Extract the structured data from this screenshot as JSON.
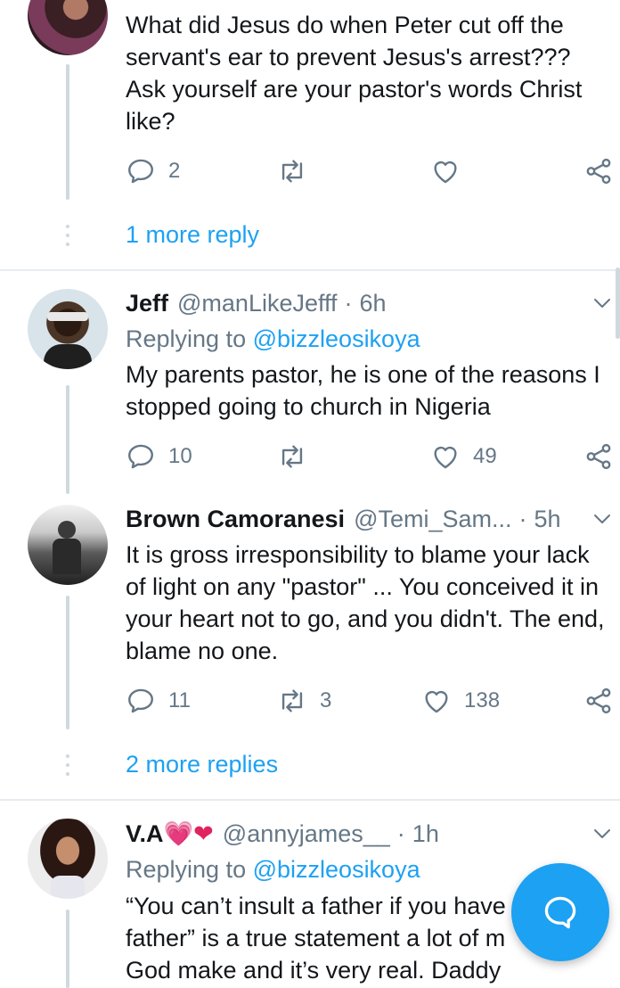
{
  "tweets": [
    {
      "text": "What did Jesus do when Peter cut off the servant's ear to prevent Jesus's arrest??? Ask yourself are your pastor's words Christ like?",
      "replies": "2",
      "retweets": "",
      "likes": "",
      "more_replies": "1 more reply"
    },
    {
      "name": "Jeff",
      "handle": "@manLikeJefff",
      "time": "6h",
      "replying_prefix": "Replying to",
      "replying_to": "@bizzleosikoya",
      "text": "My parents pastor, he is one of the reasons I stopped going to church in Nigeria",
      "replies": "10",
      "retweets": "",
      "likes": "49"
    },
    {
      "name": "Brown Camoranesi",
      "handle": "@Temi_Sam...",
      "time": "5h",
      "text": "It is gross irresponsibility to blame your lack of light on any \"pastor\" ... You conceived it in your heart not to go, and you didn't. The end, blame no one.",
      "replies": "11",
      "retweets": "3",
      "likes": "138",
      "more_replies": "2 more replies"
    },
    {
      "name": "V.A",
      "name_emojis": "💗❤",
      "handle": "@annyjames__",
      "time": "1h",
      "replying_prefix": "Replying to",
      "replying_to": "@bizzleosikoya",
      "text": "“You can’t insult a father if you have father” is a true statement a lot of m God make and it’s very real. Daddy Freeze"
    }
  ],
  "separator": "·",
  "colors": {
    "accent": "#1da1f2",
    "muted": "#657786",
    "line": "#cfd9de",
    "text": "#14171a"
  },
  "icons": [
    "reply-icon",
    "retweet-icon",
    "like-icon",
    "share-icon",
    "chevron-down-icon",
    "compose-reply-icon"
  ]
}
